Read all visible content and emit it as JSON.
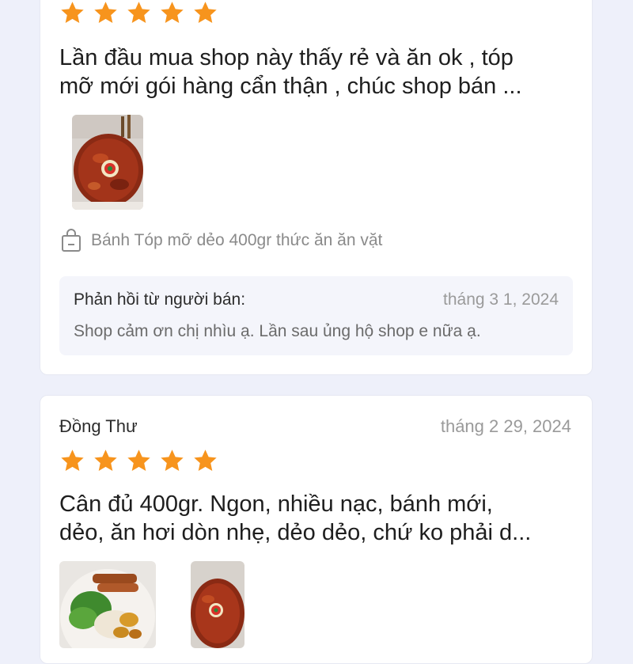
{
  "review1": {
    "rating": 5,
    "text": "Lần đầu mua shop này thấy rẻ và ăn ok , tóp\nmỡ mới gói hàng cẩn thận , chúc shop bán ...",
    "product": "Bánh Tóp mỡ dẻo 400gr  thức ăn ăn vặt",
    "reply": {
      "title": "Phản hồi từ người bán:",
      "date": "tháng 3 1, 2024",
      "body": "Shop cảm ơn chị nhìu ạ. Lần sau ủng hộ shop e nữa ạ."
    }
  },
  "review2": {
    "reviewer": "Đồng Thư",
    "date": "tháng 2 29, 2024",
    "rating": 5,
    "text": "Cân đủ 400gr. Ngon, nhiều nạc, bánh mới,\ndẻo, ăn hơi dòn nhẹ, dẻo dẻo, chứ ko phải d..."
  },
  "colors": {
    "star": "#f7941d",
    "background": "#eef0fa",
    "card": "#ffffff",
    "reply_bg": "#f4f5fb"
  },
  "icons": {
    "star": "star-icon",
    "product": "shopping-bag-icon"
  }
}
